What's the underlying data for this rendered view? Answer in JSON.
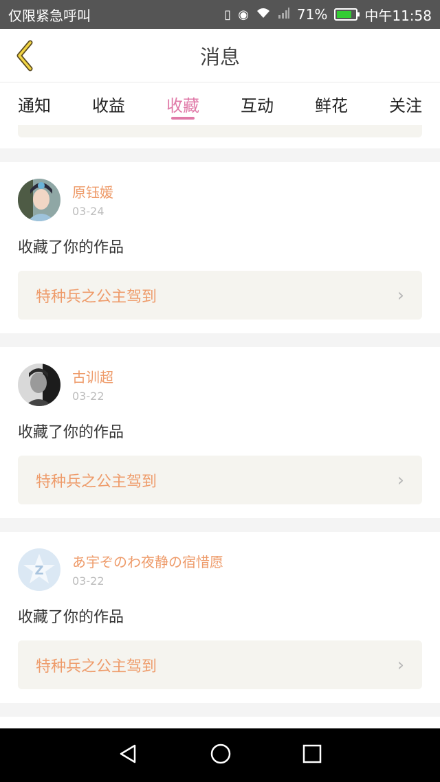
{
  "status_bar": {
    "left_text": "仅限紧急呼叫",
    "battery": "71%",
    "time": "中午11:58"
  },
  "header": {
    "title": "消息"
  },
  "tabs": [
    {
      "label": "通知",
      "active": false
    },
    {
      "label": "收益",
      "active": false
    },
    {
      "label": "收藏",
      "active": true
    },
    {
      "label": "互动",
      "active": false
    },
    {
      "label": "鲜花",
      "active": false
    },
    {
      "label": "关注",
      "active": false
    }
  ],
  "messages": [
    {
      "username": "原钰媛",
      "date": "03-24",
      "action": "收藏了你的作品",
      "work": "特种兵之公主驾到"
    },
    {
      "username": "古训超",
      "date": "03-22",
      "action": "收藏了你的作品",
      "work": "特种兵之公主驾到"
    },
    {
      "username": "あ宇ぞのわ夜静の宿惜愿",
      "date": "03-22",
      "action": "收藏了你的作品",
      "work": "特种兵之公主驾到"
    }
  ],
  "colors": {
    "accent": "#e07aa8",
    "username": "#ee9b6a",
    "link_bg": "#f5f4ef"
  }
}
